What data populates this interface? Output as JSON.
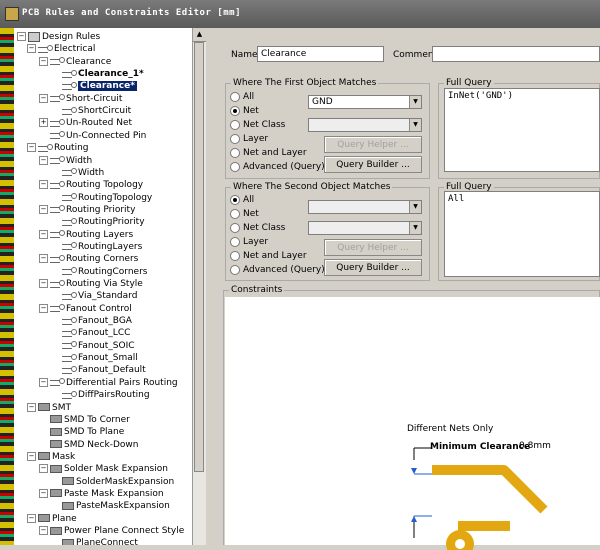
{
  "window": {
    "title": "PCB Rules and Constraints Editor [mm]"
  },
  "tree": {
    "root": "Design Rules",
    "electrical": "Electrical",
    "clearance": "Clearance",
    "clearance_1": "Clearance_1*",
    "clearance_sel": "Clearance*",
    "short_circuit": "Short-Circuit",
    "short_circuit_rule": "ShortCircuit",
    "unrouted": "Un-Routed Net",
    "unconnected": "Un-Connected Pin",
    "routing": "Routing",
    "width": "Width",
    "width_rule": "Width",
    "topology": "Routing Topology",
    "topology_rule": "RoutingTopology",
    "priority": "Routing Priority",
    "priority_rule": "RoutingPriority",
    "layers": "Routing Layers",
    "layers_rule": "RoutingLayers",
    "corners": "Routing Corners",
    "corners_rule": "RoutingCorners",
    "via_style": "Routing Via Style",
    "via_rule": "Via_Standard",
    "fanout": "Fanout Control",
    "fanout_bga": "Fanout_BGA",
    "fanout_lcc": "Fanout_LCC",
    "fanout_soic": "Fanout_SOIC",
    "fanout_small": "Fanout_Small",
    "fanout_default": "Fanout_Default",
    "diff_pairs": "Differential Pairs Routing",
    "diff_rule": "DiffPairsRouting",
    "smt": "SMT",
    "smd_corner": "SMD To Corner",
    "smd_plane": "SMD To Plane",
    "smd_neck": "SMD Neck-Down",
    "mask": "Mask",
    "solder_mask": "Solder Mask Expansion",
    "solder_rule": "SolderMaskExpansion",
    "paste_mask": "Paste Mask Expansion",
    "paste_rule": "PasteMaskExpansion",
    "plane": "Plane",
    "power_plane": "Power Plane Connect Style",
    "plane_connect": "PlaneConnect"
  },
  "form": {
    "name_label": "Name",
    "name_value": "Clearance",
    "comment_label": "Comment",
    "comment_value": ""
  },
  "first": {
    "title": "Where The First Object Matches",
    "all": "All",
    "net": "Net",
    "net_class": "Net Class",
    "layer": "Layer",
    "net_and_layer": "Net and Layer",
    "advanced": "Advanced (Query)",
    "net_value": "GND",
    "query_helper": "Query Helper ...",
    "query_builder": "Query Builder ...",
    "full_query_title": "Full Query",
    "full_query": "InNet('GND')"
  },
  "second": {
    "title": "Where The Second Object Matches",
    "all": "All",
    "net": "Net",
    "net_class": "Net Class",
    "layer": "Layer",
    "net_and_layer": "Net and Layer",
    "advanced": "Advanced (Query)",
    "query_helper": "Query Helper ...",
    "query_builder": "Query Builder ...",
    "full_query_title": "Full Query",
    "full_query": "All"
  },
  "constraints": {
    "title": "Constraints",
    "different_nets": "Different Nets Only",
    "min_clearance_label": "Minimum Clearance",
    "min_clearance_value": "0.8mm"
  },
  "colors": {
    "selection": "#0a246a",
    "trace": "#e3a712"
  }
}
